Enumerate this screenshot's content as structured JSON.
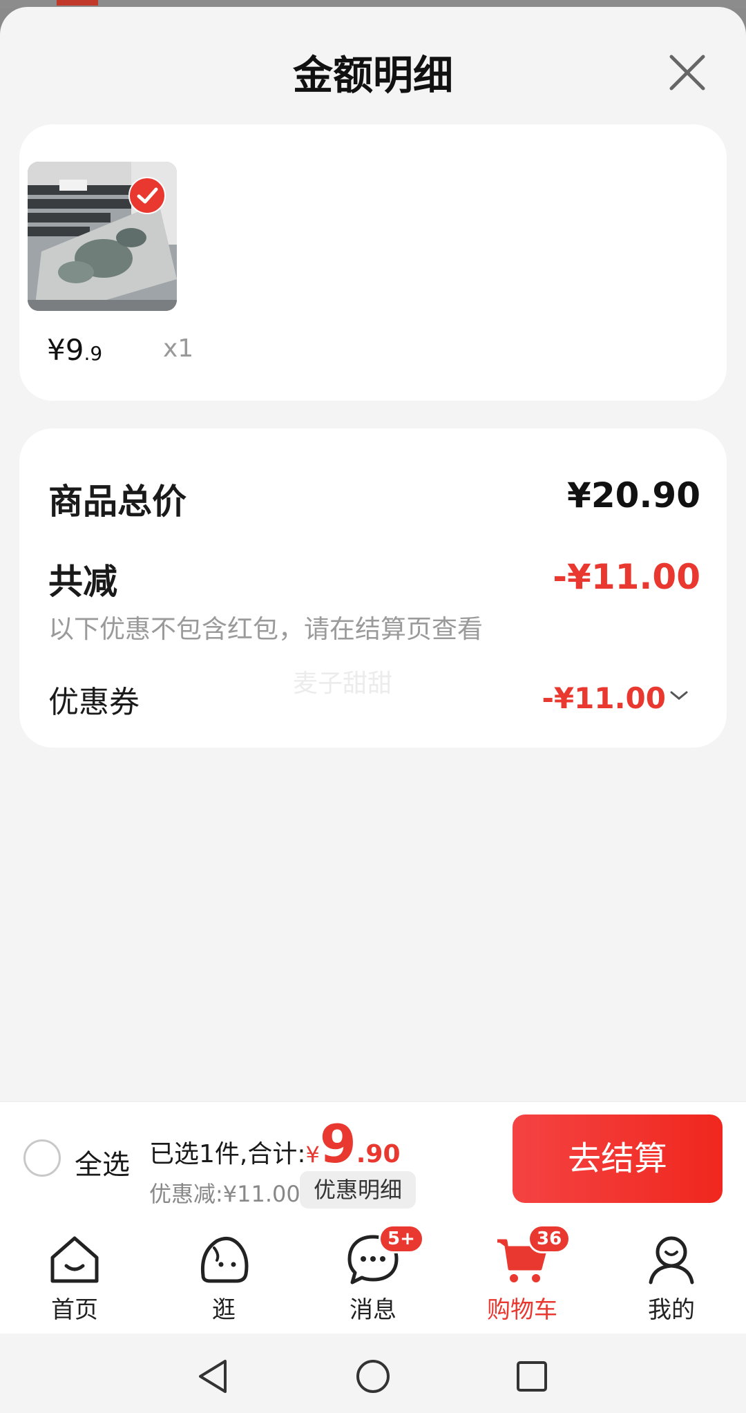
{
  "sheet": {
    "title": "金额明细"
  },
  "item": {
    "price_main": "¥9",
    "price_decimal": ".9",
    "quantity": "x1",
    "selected": true
  },
  "summary": {
    "total_label": "商品总价",
    "total_value": "¥20.90",
    "reduce_label": "共减",
    "reduce_value": "-¥11.00",
    "note": "以下优惠不包含红包，请在结算页查看",
    "coupon_label": "优惠券",
    "coupon_value": "-¥11.00",
    "watermark": "麦子甜甜"
  },
  "checkout": {
    "select_all": "全选",
    "selected_prefix": "已选1件,合计:",
    "currency": "¥",
    "total_int": "9",
    "total_dec": ".90",
    "discount_text": "优惠减:¥11.00",
    "detail_chip": "优惠明细",
    "button": "去结算"
  },
  "tabs": [
    {
      "label": "首页",
      "icon": "home-icon"
    },
    {
      "label": "逛",
      "icon": "browse-icon"
    },
    {
      "label": "消息",
      "icon": "message-icon",
      "badge": "5+"
    },
    {
      "label": "购物车",
      "icon": "cart-icon",
      "badge": "36",
      "active": true
    },
    {
      "label": "我的",
      "icon": "profile-icon"
    }
  ],
  "colors": {
    "accent": "#e8382f",
    "background": "#f4f4f4"
  }
}
